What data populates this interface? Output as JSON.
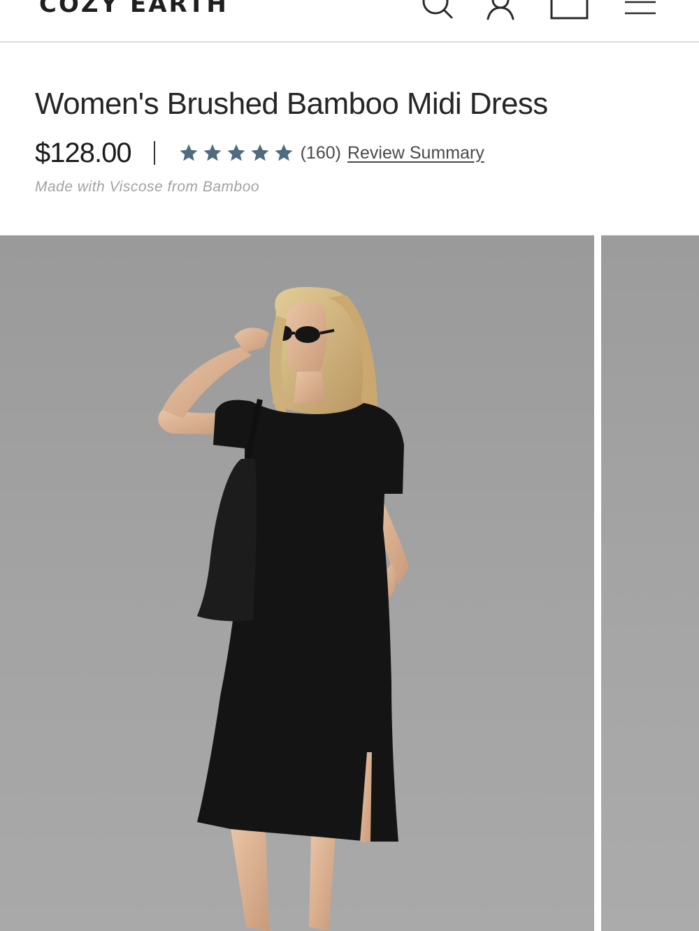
{
  "header": {
    "logo_text": "COZY EARTH",
    "icons": [
      "search-icon",
      "account-icon",
      "cart-icon",
      "menu-icon"
    ]
  },
  "product": {
    "title": "Women's Brushed Bamboo Midi Dress",
    "price": "$128.00",
    "rating_stars": 5,
    "review_count": "(160)",
    "review_link_label": "Review Summary",
    "material_note": "Made with Viscose from Bamboo"
  },
  "colors": {
    "star": "#4f6b7e",
    "text": "#262626",
    "muted": "#a2a2a2",
    "image_bg": "#a3a3a3",
    "dress": "#141414"
  },
  "gallery": {
    "main_image": "woman-in-black-midi-dress-photo",
    "next_image": "next-product-photo-preview"
  }
}
